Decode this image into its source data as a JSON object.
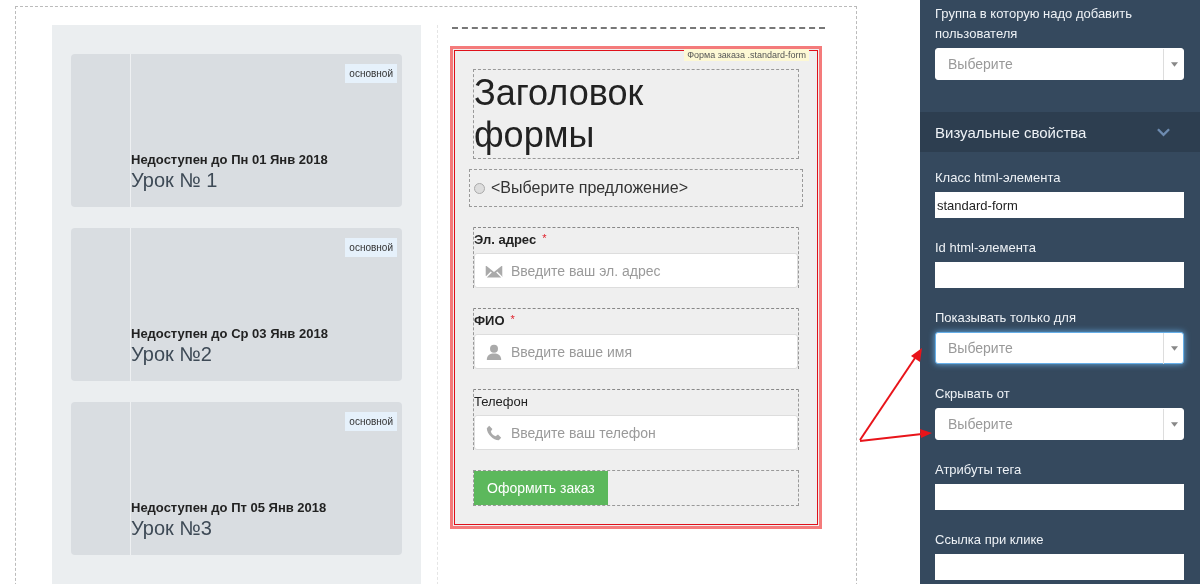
{
  "lessons": [
    {
      "badge": "основной",
      "availability": "Недоступен до Пн 01 Янв 2018",
      "title": "Урок № 1"
    },
    {
      "badge": "основной",
      "availability": "Недоступен до Ср 03 Янв 2018",
      "title": "Урок №2"
    },
    {
      "badge": "основной",
      "availability": "Недоступен до Пт 05 Янв 2018",
      "title": "Урок №3"
    }
  ],
  "form": {
    "tag": "Форма заказа .standard-form",
    "heading": "Заголовок формы",
    "offer": {
      "label": "<Выберите предложение>",
      "selected": false
    },
    "fields": [
      {
        "label": "Эл. адрес",
        "required_mark": "*",
        "kind": "email",
        "placeholder": "Введите ваш эл. адрес"
      },
      {
        "label": "ФИО",
        "required_mark": "*",
        "kind": "name",
        "placeholder": "Введите ваше имя"
      },
      {
        "label": "Телефон",
        "kind": "phone",
        "placeholder": "Введите ваш телефон"
      }
    ],
    "submit": "Оформить заказ"
  },
  "panel": {
    "fields": [
      {
        "kind": "select",
        "label": "Группа в которую надо добавить пользователя",
        "placeholder": "Выберите",
        "focused": false
      }
    ],
    "section": {
      "title": "Визуальные свойства",
      "expanded": true
    },
    "section_fields": [
      {
        "kind": "text",
        "label": "Класс html-элемента",
        "value": "standard-form"
      },
      {
        "kind": "text",
        "label": "Id html-элемента"
      },
      {
        "kind": "select",
        "label": "Показывать только для",
        "placeholder": "Выберите",
        "focused": true
      },
      {
        "kind": "select",
        "label": "Скрывать от",
        "placeholder": "Выберите",
        "focused": false
      },
      {
        "kind": "text",
        "label": "Атрибуты тега"
      },
      {
        "kind": "text",
        "label": "Ссылка при клике"
      }
    ]
  }
}
